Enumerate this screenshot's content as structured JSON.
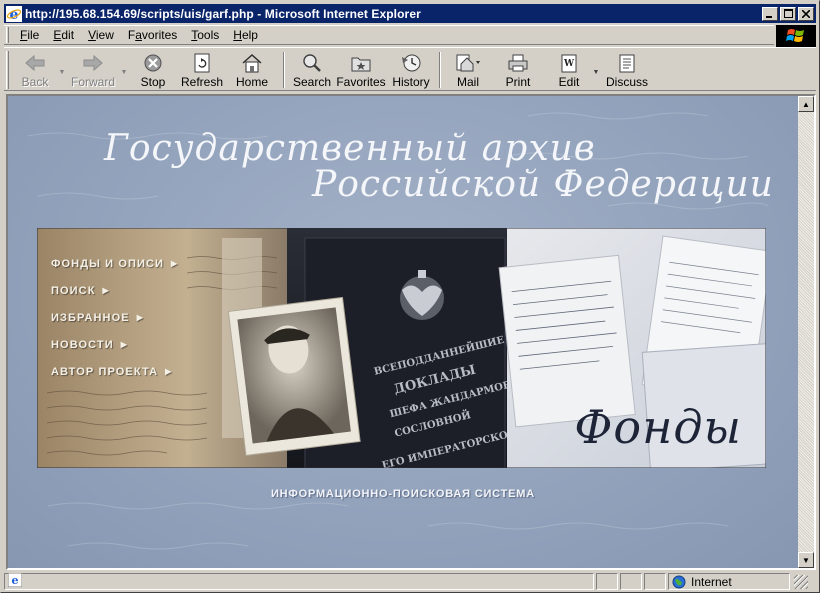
{
  "window": {
    "title": "http://195.68.154.69/scripts/uis/garf.php - Microsoft Internet Explorer",
    "minimize": "_",
    "maximize": "□",
    "close": "✕"
  },
  "menu": [
    {
      "label": "File",
      "key": "F",
      "rest": "ile"
    },
    {
      "label": "Edit",
      "key": "E",
      "rest": "dit"
    },
    {
      "label": "View",
      "key": "V",
      "rest": "iew"
    },
    {
      "label": "Favorites",
      "key": "a",
      "pre": "F",
      "rest": "vorites"
    },
    {
      "label": "Tools",
      "key": "T",
      "rest": "ools"
    },
    {
      "label": "Help",
      "key": "H",
      "rest": "elp"
    }
  ],
  "toolbar": {
    "back": "Back",
    "forward": "Forward",
    "stop": "Stop",
    "refresh": "Refresh",
    "home": "Home",
    "search": "Search",
    "favorites": "Favorites",
    "history": "History",
    "mail": "Mail",
    "print": "Print",
    "edit": "Edit",
    "discuss": "Discuss"
  },
  "page": {
    "heading_line1": "Государственный архив",
    "heading_line2": "Российской Федерации",
    "nav": [
      "ФОНДЫ И ОПИСИ",
      "ПОИСК",
      "ИЗБРАННОЕ",
      "НОВОСТИ",
      "АВТОР ПРОЕКТА"
    ],
    "nav_arrow": "▶",
    "section_word": "Фонды",
    "subtitle": "ИНФОРМАЦИОННО-ПОИСКОВАЯ СИСТЕМА",
    "book_text": [
      "ВСЕПОДДАННЕЙШИЕ",
      "ДОКЛАДЫ",
      "ШЕФА ЖАНДАРМОВ",
      "СОСЛОВНОЙ",
      "ЕГО ИМПЕРАТОРСКОГО"
    ]
  },
  "status": {
    "zone": "Internet"
  },
  "colors": {
    "titlebar": "#0a246a",
    "chrome": "#d4d0c8",
    "page_bg": "#93a3bc",
    "nav_text": "#f4f0e6",
    "section_word": "#1e2438"
  }
}
